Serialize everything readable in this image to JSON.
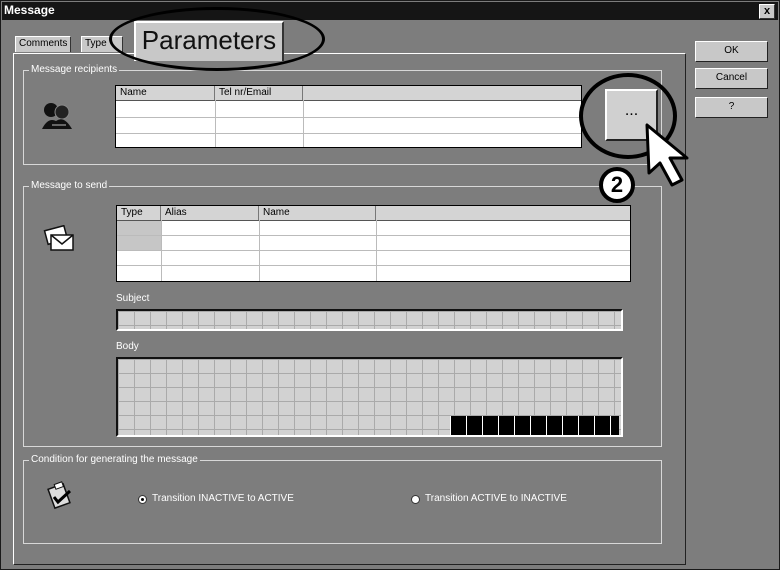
{
  "window": {
    "title": "Message",
    "close_label": "x"
  },
  "tabs": [
    {
      "label": "Comments"
    },
    {
      "label": "Type"
    },
    {
      "label": "Parameters"
    }
  ],
  "buttons": {
    "ok": "OK",
    "cancel": "Cancel",
    "help": "?",
    "browse": "..."
  },
  "callout_number": "2",
  "recipients": {
    "legend": "Message recipients",
    "columns": [
      "Name",
      "Tel nr/Email"
    ]
  },
  "message": {
    "legend": "Message to send",
    "columns": [
      "Type",
      "Alias",
      "Name"
    ],
    "subject_label": "Subject",
    "body_label": "Body"
  },
  "condition": {
    "legend": "Condition for generating the message",
    "option1": "Transition INACTIVE to ACTIVE",
    "option2": "Transition ACTIVE to INACTIVE",
    "selected": "option1"
  },
  "icons": {
    "recipients": "people-icon",
    "message": "envelopes-icon",
    "condition": "clipboard-check-icon",
    "cursor": "mouse-pointer-icon"
  }
}
